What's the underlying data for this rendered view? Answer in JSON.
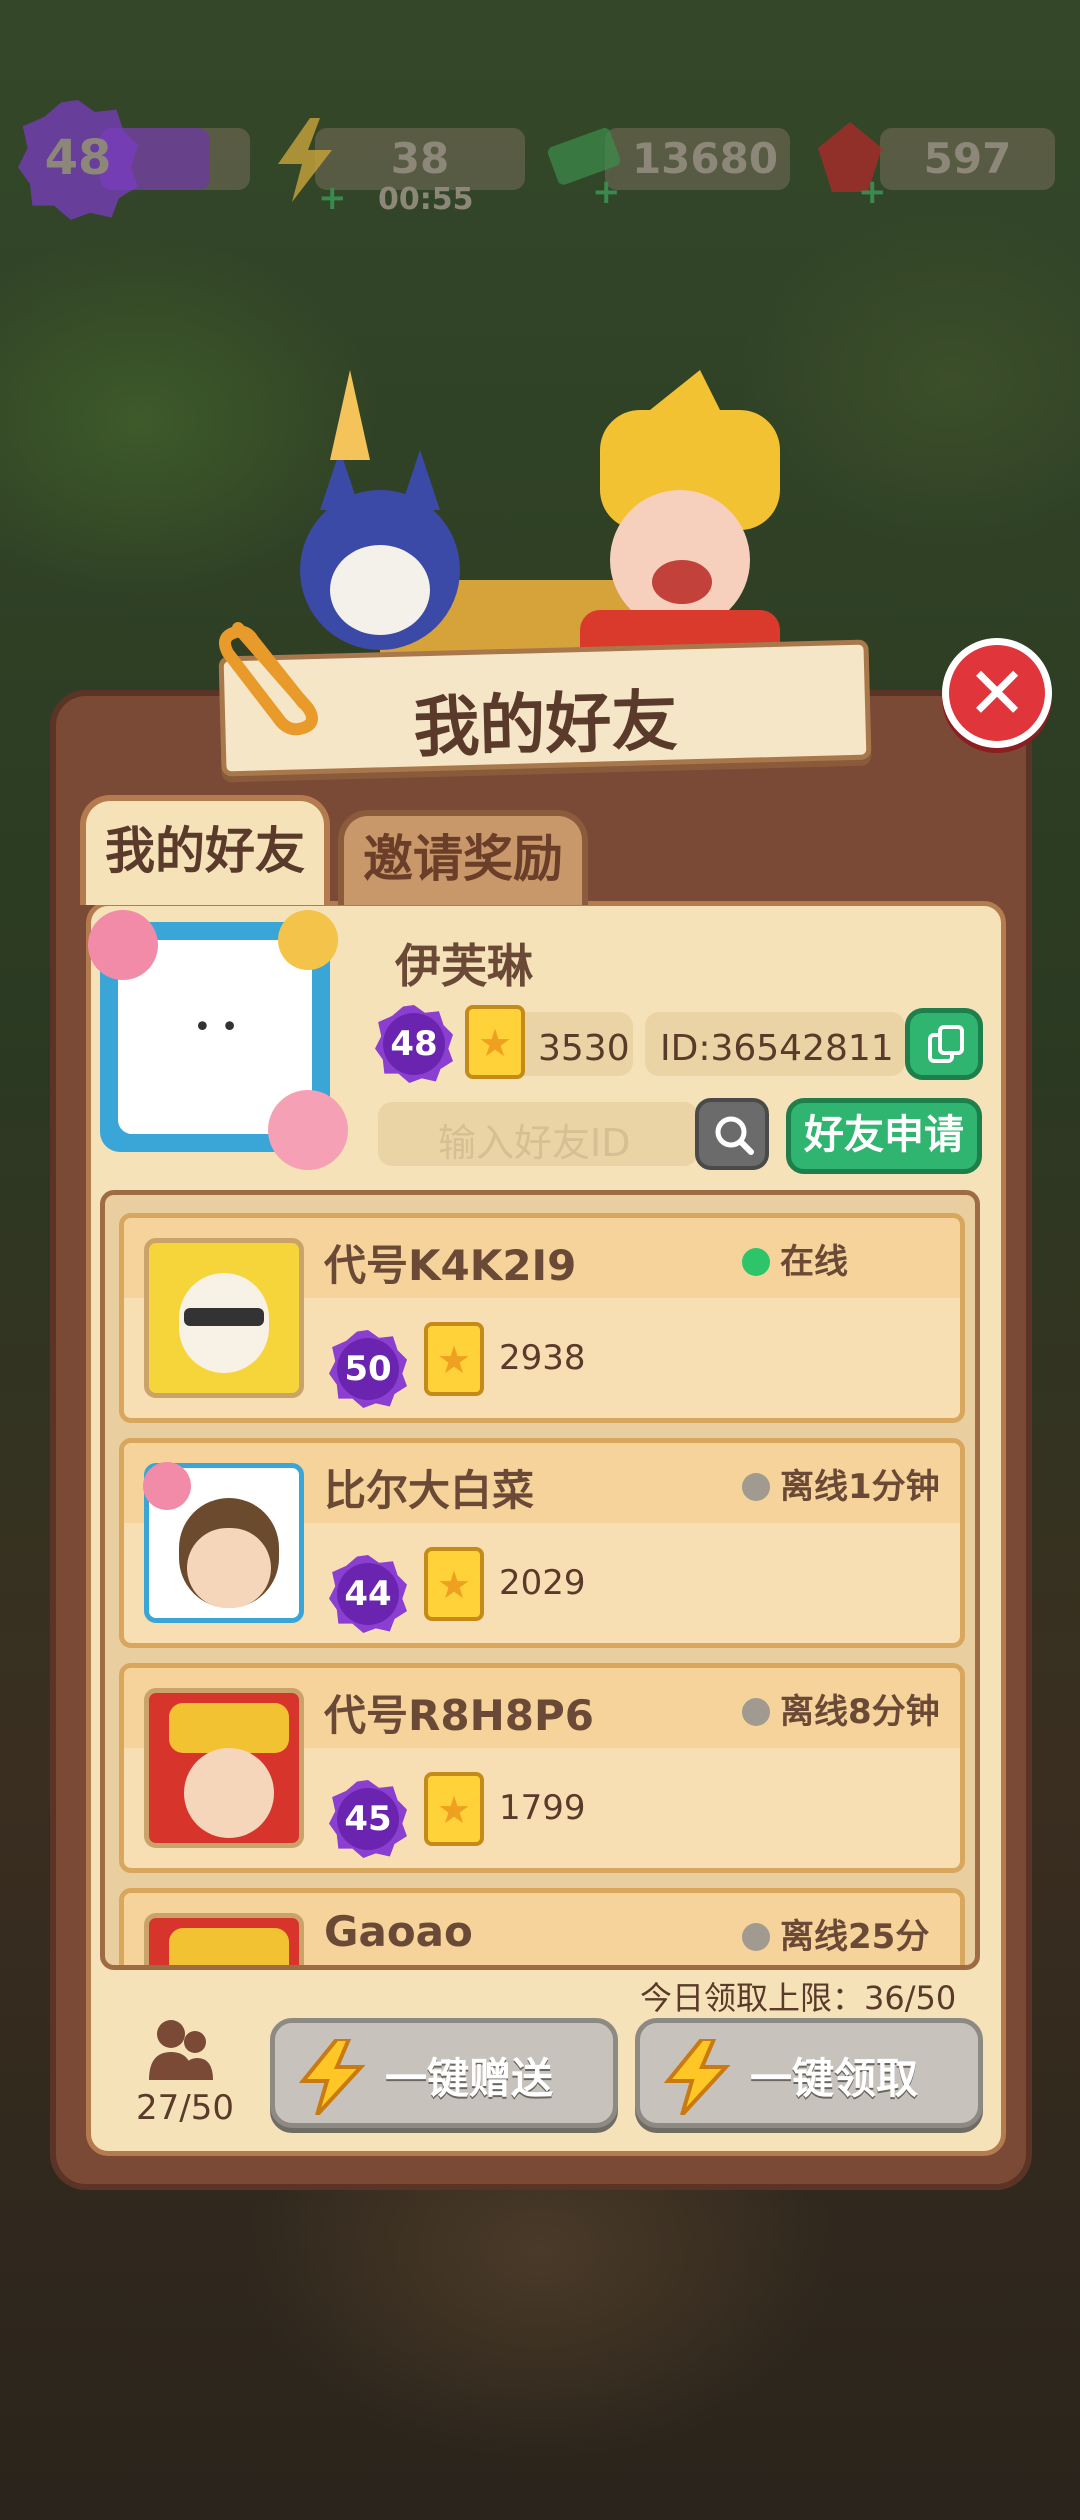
{
  "hud": {
    "level": "48",
    "energy": "38",
    "energy_timer": "00:55",
    "cash": "13680",
    "gems": "597"
  },
  "title": "我的好友",
  "tabs": {
    "friends": "我的好友",
    "invite": "邀请奖励"
  },
  "profile": {
    "name": "伊芙琳",
    "level": "48",
    "stars": "3530",
    "id": "ID:36542811"
  },
  "search": {
    "placeholder": "输入好友ID",
    "request_label": "好友申请"
  },
  "friends": [
    {
      "name": "代号K4K2I9",
      "level": "50",
      "stars": "2938",
      "status": "在线",
      "online": true
    },
    {
      "name": "比尔大白菜",
      "level": "44",
      "stars": "2029",
      "status": "离线1分钟",
      "online": false
    },
    {
      "name": "代号R8H8P6",
      "level": "45",
      "stars": "1799",
      "status": "离线8分钟",
      "online": false
    },
    {
      "name": "Gaoao",
      "level": "",
      "stars": "",
      "status": "离线25分",
      "online": false
    }
  ],
  "footer": {
    "daily_limit": "今日领取上限：36/50",
    "friend_count": "27/50",
    "send_all": "一键赠送",
    "claim_all": "一键领取"
  },
  "colors": {
    "online": "#2ec56a",
    "offline": "#a09a90",
    "accent_green": "#2fb56f",
    "close_red": "#e0353a"
  }
}
